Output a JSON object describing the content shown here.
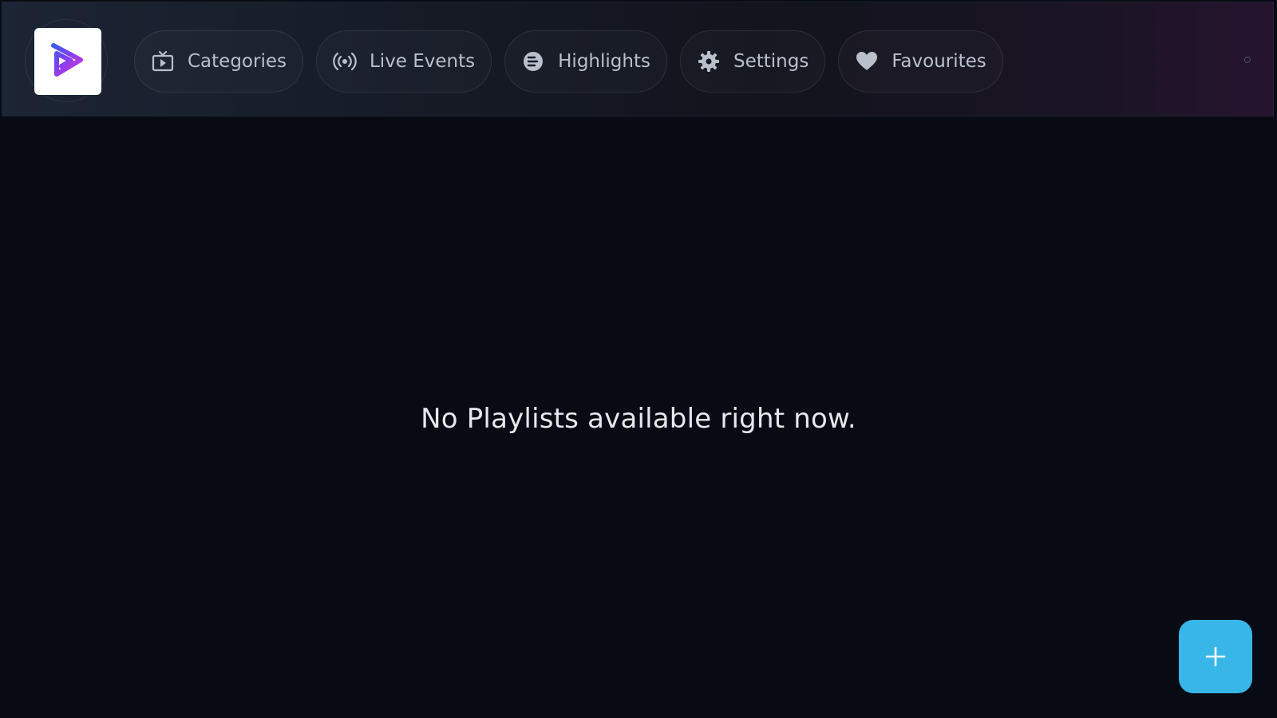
{
  "header": {
    "logo_icon": "play-logo-icon",
    "nav": [
      {
        "label": "Categories",
        "icon": "tv-icon"
      },
      {
        "label": "Live Events",
        "icon": "broadcast-icon"
      },
      {
        "label": "Highlights",
        "icon": "highlights-icon"
      },
      {
        "label": "Settings",
        "icon": "gear-icon"
      },
      {
        "label": "Favourites",
        "icon": "heart-icon"
      }
    ]
  },
  "main": {
    "empty_message": "No Playlists available right now."
  },
  "fab": {
    "icon": "plus-icon"
  },
  "colors": {
    "background": "#080b14",
    "accent": "#38b6e8",
    "nav_text": "#b9c0cc"
  }
}
